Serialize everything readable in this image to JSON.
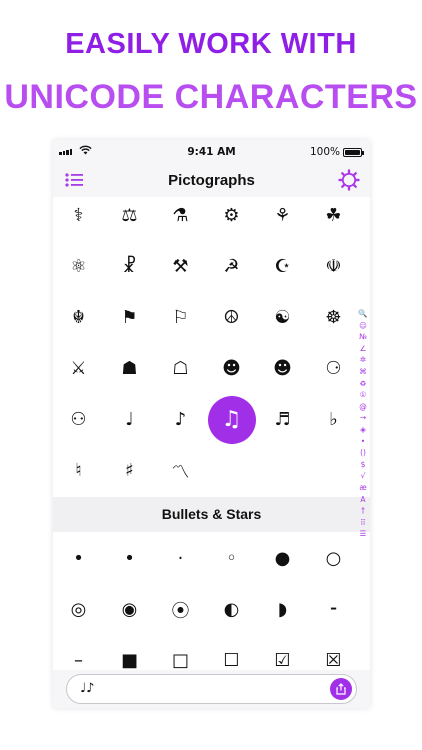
{
  "promo": {
    "line1": "EASILY WORK WITH",
    "line2": "UNICODE CHARACTERS"
  },
  "colors": {
    "accent": "#a22fe8",
    "headline1": "#8f1fe6",
    "headline2": "#b84df0"
  },
  "status_bar": {
    "time": "9:41 AM",
    "battery": "100%"
  },
  "nav": {
    "title": "Pictographs",
    "left_icon": "list-icon",
    "right_icon": "gear-icon"
  },
  "pictographs": {
    "selected": "♫",
    "rows": [
      [
        "⚕",
        "⚖",
        "⚗",
        "⚙",
        "⚘",
        "☘"
      ],
      [
        "⚛",
        "☧",
        "⚒",
        "☭",
        "☪",
        "☫"
      ],
      [
        "☬",
        "⚑",
        "⚐",
        "☮",
        "☯",
        "☸"
      ],
      [
        "⚔",
        "☗",
        "☖",
        "☻",
        "☻",
        "⚆"
      ],
      [
        "⚇",
        "♩",
        "♪",
        "♫",
        "♬",
        "♭"
      ],
      [
        "♮",
        "♯",
        "〽"
      ]
    ]
  },
  "bullets": {
    "title": "Bullets & Stars",
    "rows": [
      [
        "•",
        "•",
        "·",
        "◦",
        "●",
        "○"
      ],
      [
        "◎",
        "◉",
        "⦿",
        "◐",
        "◗",
        "⁃"
      ],
      [
        "–",
        "■",
        "□",
        "☐",
        "☑",
        "☒"
      ]
    ]
  },
  "index_sidebar": [
    "🔍",
    "☺",
    "№",
    "∠",
    "✲",
    "⌘",
    "♻",
    "①",
    "@",
    "→",
    "◈",
    "•",
    "()",
    "$",
    "√",
    "æ",
    "A",
    "†",
    "⠿",
    "☰"
  ],
  "input": {
    "value": "♩♪",
    "share_icon": "share-icon"
  }
}
